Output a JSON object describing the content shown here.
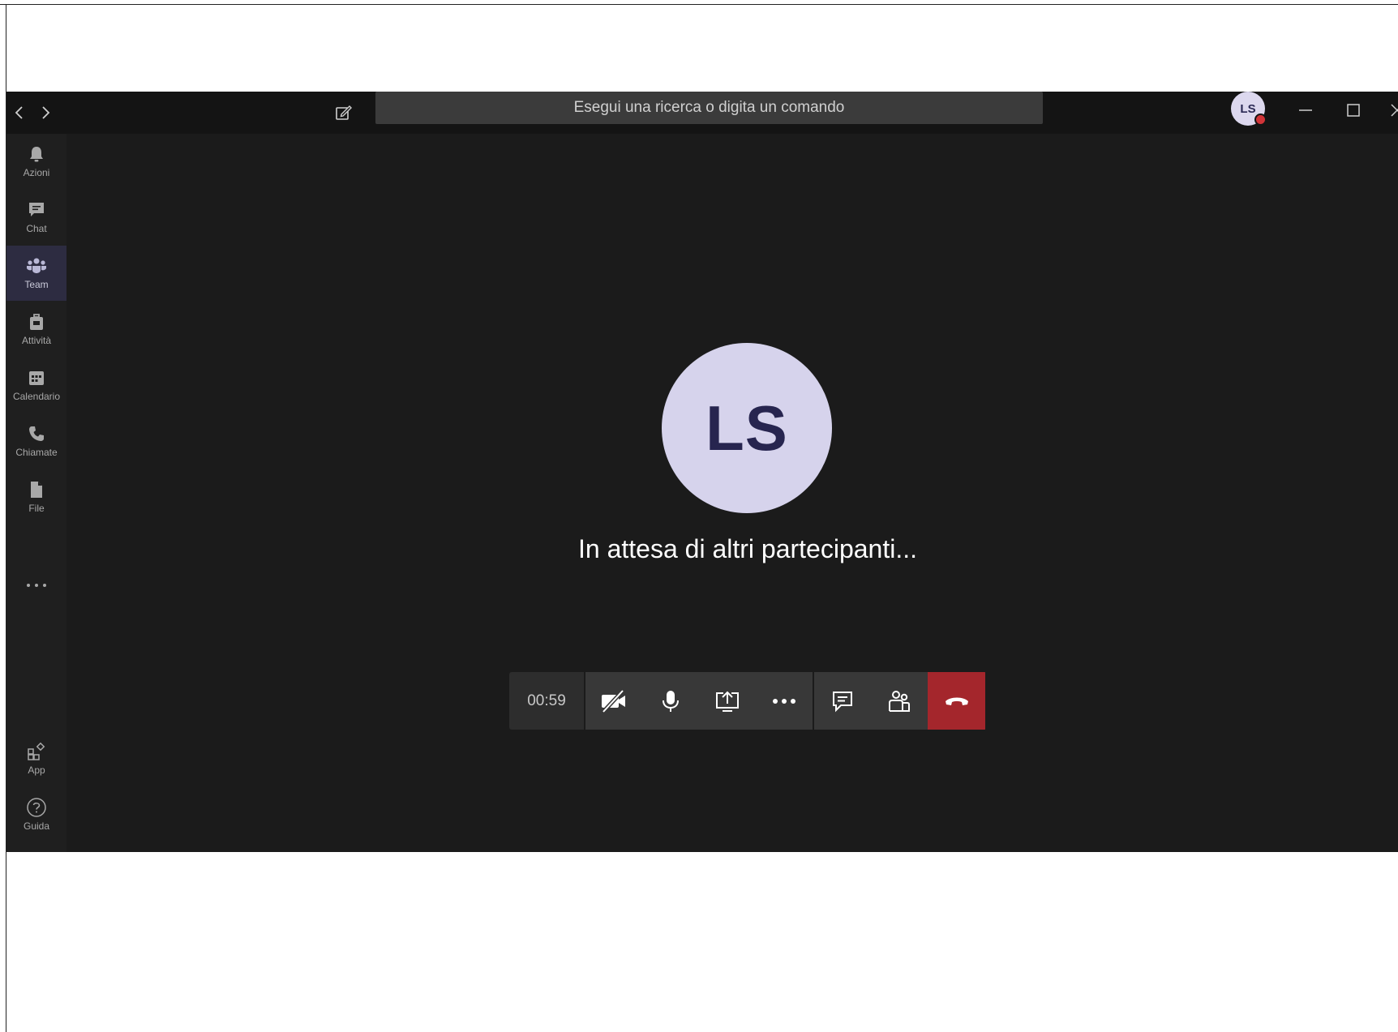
{
  "titlebar": {
    "back_icon": "chevron-left-icon",
    "forward_icon": "chevron-right-icon",
    "compose_icon": "compose-icon",
    "search_placeholder": "Esegui una ricerca o digita un comando",
    "user_initials": "LS",
    "presence_color": "#d13438",
    "window_buttons": [
      "minimize-icon",
      "maximize-icon",
      "close-icon"
    ]
  },
  "sidebar": {
    "items": [
      {
        "label": "Azioni",
        "icon": "bell-icon"
      },
      {
        "label": "Chat",
        "icon": "chat-icon"
      },
      {
        "label": "Team",
        "icon": "teams-icon",
        "active": true
      },
      {
        "label": "Attività",
        "icon": "assignments-icon"
      },
      {
        "label": "Calendario",
        "icon": "calendar-icon"
      },
      {
        "label": "Chiamate",
        "icon": "phone-icon"
      },
      {
        "label": "File",
        "icon": "file-icon"
      }
    ],
    "more_icon": "more-horizontal-icon",
    "bottom_items": [
      {
        "label": "App",
        "icon": "apps-icon"
      },
      {
        "label": "Guida",
        "icon": "help-icon"
      }
    ]
  },
  "call": {
    "avatar_initials": "LS",
    "status_text": "In attesa di altri partecipanti...",
    "timer": "00:59",
    "controls": [
      "camera-off-icon",
      "microphone-icon",
      "share-screen-icon",
      "more-actions-icon",
      "show-conversation-icon",
      "show-participants-icon",
      "hang-up-icon"
    ],
    "hangup_color": "#a4262c"
  },
  "colors": {
    "app_background": "#1b1b1b",
    "titlebar": "#141414",
    "sidebar": "#1f1f1f",
    "active_rail": "#2d2c41",
    "avatar_fill": "#d6d3ec",
    "avatar_text": "#27254f"
  }
}
